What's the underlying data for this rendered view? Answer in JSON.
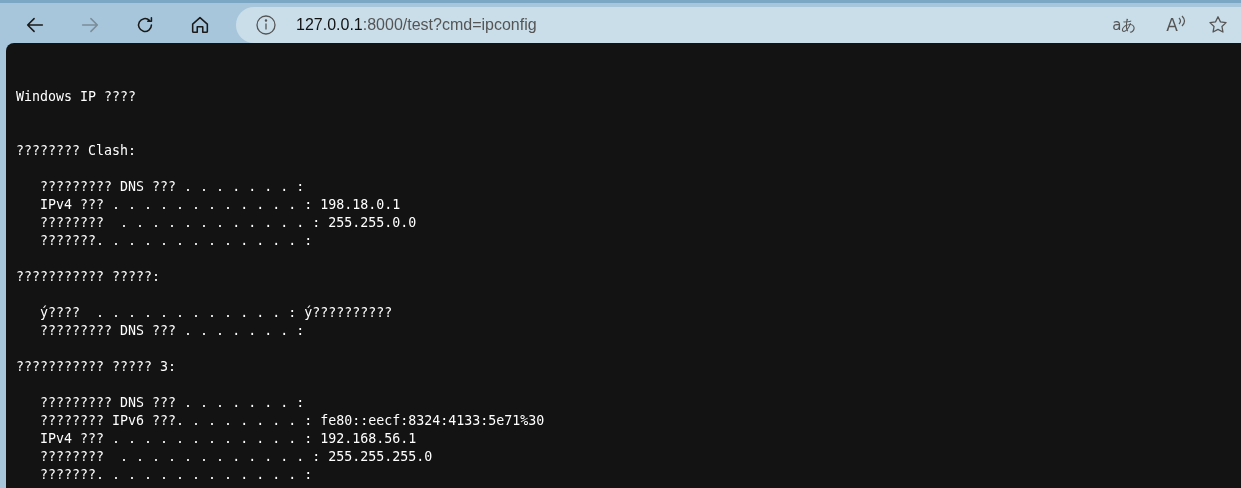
{
  "toolbar": {
    "buttons": [
      {
        "kind": "back",
        "disabled": false
      },
      {
        "kind": "forward",
        "disabled": true
      },
      {
        "kind": "refresh",
        "disabled": false
      },
      {
        "kind": "home",
        "disabled": false
      }
    ]
  },
  "address_bar": {
    "host": "127.0.0.1",
    "rest": ":8000/test?cmd=ipconfig",
    "translate_glyph": "aあ",
    "read_aloud_glyph": "A"
  },
  "console": {
    "title": "Windows IP ????",
    "sections": [
      {
        "heading": "???????? Clash:",
        "entries": [
          "????????? DNS ??? . . . . . . . :",
          "IPv4 ??? . . . . . . . . . . . . : 198.18.0.1",
          "????????  . . . . . . . . . . . . : 255.255.0.0",
          "???????. . . . . . . . . . . . . :"
        ]
      },
      {
        "heading": "??????????? ?????:",
        "entries": [
          "ý????  . . . . . . . . . . . . : ý??????????",
          "????????? DNS ??? . . . . . . . :"
        ]
      },
      {
        "heading": "??????????? ????? 3:",
        "entries": [
          "????????? DNS ??? . . . . . . . :",
          "???????? IPv6 ???. . . . . . . . : fe80::eecf:8324:4133:5e71%30",
          "IPv4 ??? . . . . . . . . . . . . : 192.168.56.1",
          "????????  . . . . . . . . . . . . : 255.255.255.0",
          "???????. . . . . . . . . . . . . :"
        ]
      }
    ]
  }
}
